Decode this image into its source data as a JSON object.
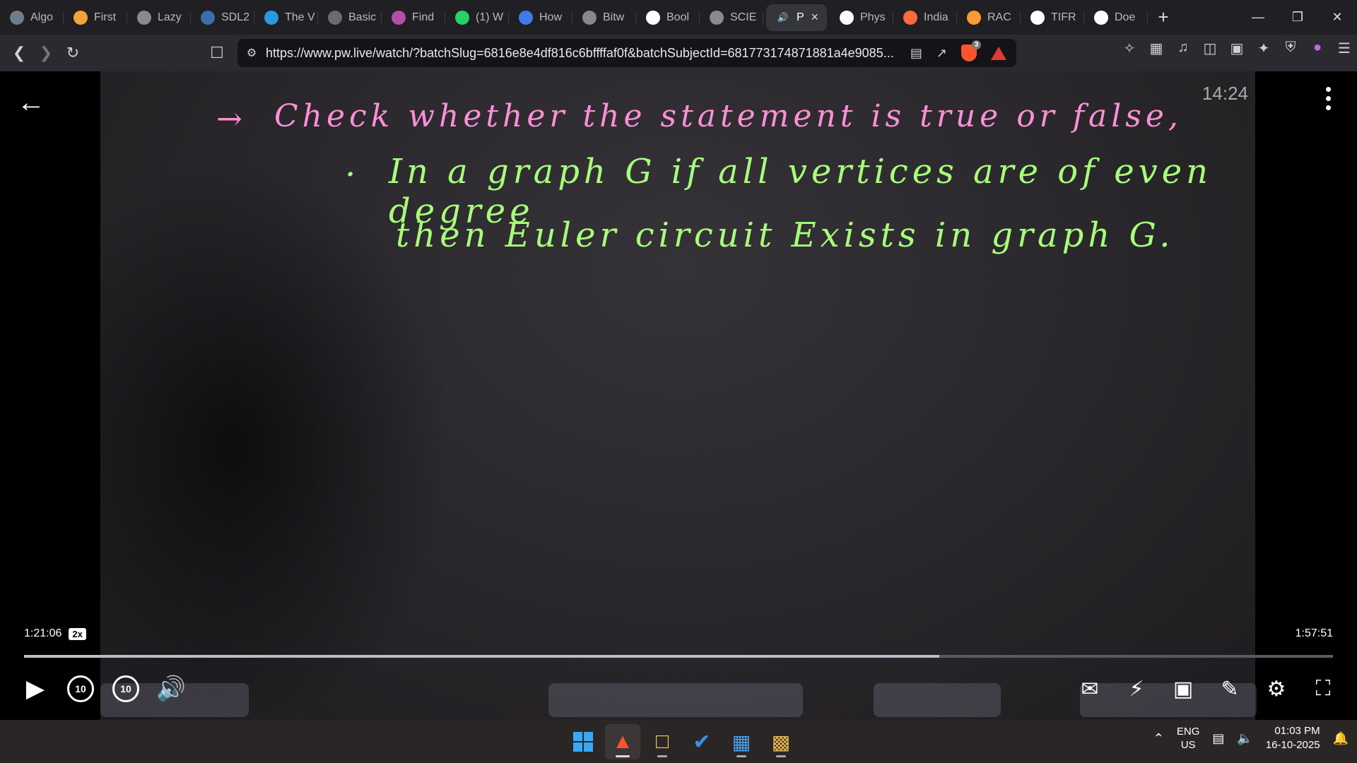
{
  "tabs": [
    {
      "label": "Algo",
      "icon": "globe-icon",
      "color": "#6f7c8a"
    },
    {
      "label": "First",
      "icon": "bitcoin-icon",
      "color": "#f2a33a"
    },
    {
      "label": "Lazy",
      "icon": "globe-icon",
      "color": "#8a8a8a"
    },
    {
      "label": "SDL2",
      "icon": "sdl-icon",
      "color": "#3b6ea8"
    },
    {
      "label": "The V",
      "icon": "code-icon",
      "color": "#2a9ae0"
    },
    {
      "label": "Basic",
      "icon": "cpp-icon",
      "color": "#6c6c6c"
    },
    {
      "label": "Find",
      "icon": "brain-icon",
      "color": "#b34ea8"
    },
    {
      "label": "(1) W",
      "icon": "whatsapp-icon",
      "color": "#25d366"
    },
    {
      "label": "How",
      "icon": "bookmark-icon",
      "color": "#3f7be6"
    },
    {
      "label": "Bitw",
      "icon": "ortto-icon",
      "color": "#888888"
    },
    {
      "label": "Bool",
      "icon": "google-icon",
      "color": "#ffffff"
    },
    {
      "label": "SCIE",
      "icon": "globe-icon",
      "color": "#8a8a8a"
    },
    {
      "label": "P",
      "icon": "speaker-icon",
      "color": "#ffffff",
      "active": true
    },
    {
      "label": "Phys",
      "icon": "wikipedia-icon",
      "color": "#ffffff"
    },
    {
      "label": "India",
      "icon": "flag-icon",
      "color": "#ff6a3a"
    },
    {
      "label": "RAC",
      "icon": "india-flag-icon",
      "color": "#ff9933"
    },
    {
      "label": "TIFR",
      "icon": "google-icon",
      "color": "#ffffff"
    },
    {
      "label": "Doe",
      "icon": "google-icon",
      "color": "#ffffff"
    }
  ],
  "address": {
    "url": "https://www.pw.live/watch/?batchSlug=6816e8e4df816c6bffffaf0f&batchSubjectId=681773174871881a4e9085...",
    "shield_badge": "3"
  },
  "board": {
    "line1": "Check whether the statement is true or false,",
    "line2": "In a graph G if all vertices are of even degree",
    "line3": "then Euler circuit Exists in graph G."
  },
  "video": {
    "timestamp_overlay": "14:24",
    "elapsed": "1:21:06",
    "speed": "2x",
    "total": "1:57:51",
    "progress": 0.6875,
    "buffered": 0.6995,
    "skip_back": "10",
    "skip_forward": "10"
  },
  "taskbar": {
    "lang_line1": "ENG",
    "lang_line2": "US",
    "time": "01:03 PM",
    "date": "16-10-2025"
  },
  "colors": {
    "accent": "#6c5bf5",
    "pink_ink": "#ff8fd8",
    "green_ink": "#a8ff7a"
  }
}
